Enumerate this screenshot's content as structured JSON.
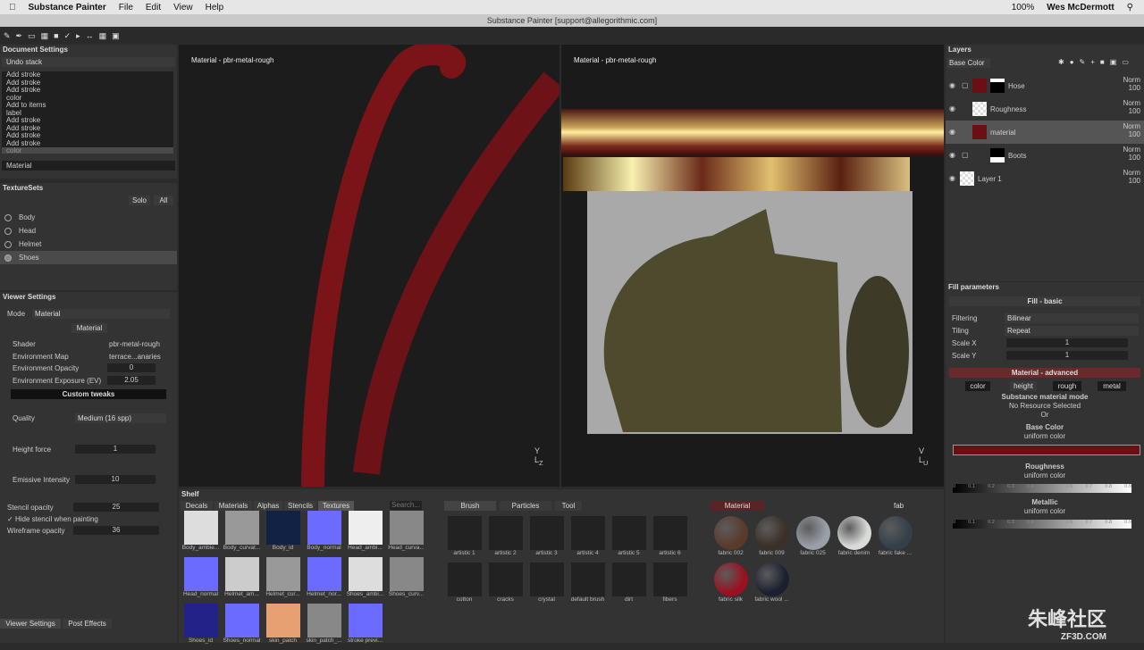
{
  "menubar": {
    "app": "Substance Painter",
    "items": [
      "File",
      "Edit",
      "View",
      "Help"
    ],
    "battery": "100%",
    "user": "Wes McDermott"
  },
  "window": {
    "title": "Substance Painter [support@allegorithmic.com]"
  },
  "doc": {
    "title": "Document Settings",
    "undo_header": "Undo stack",
    "undo": [
      "Add stroke",
      "Add stroke",
      "Add stroke",
      "color",
      "Add to items",
      "label",
      "Add stroke",
      "Add stroke",
      "Add stroke",
      "Add stroke",
      "color"
    ],
    "footer": "Material"
  },
  "texturesets": {
    "title": "TextureSets",
    "solo": "Solo",
    "all": "All",
    "items": [
      "Body",
      "Head",
      "Helmet",
      "Shoes"
    ]
  },
  "viewer": {
    "title": "Viewer Settings",
    "mode_label": "Mode",
    "mode": "Material",
    "tab": "Material",
    "shader_label": "Shader",
    "shader": "pbr-metal-rough",
    "envmap_label": "Environment Map",
    "envmap": "terrace...anaries",
    "envop_label": "Environment Opacity",
    "envop": "0",
    "envexp_label": "Environment Exposure (EV)",
    "envexp": "2.05",
    "custom": "Custom tweaks",
    "quality_label": "Quality",
    "quality": "Medium (16 spp)",
    "height_label": "Height force",
    "height": "1",
    "emissive_label": "Emissive Intensity",
    "emissive": "10",
    "stencil_label": "Stencil opacity",
    "stencil": "25",
    "hide_label": "Hide stencil when painting",
    "wire_label": "Wireframe opacity",
    "wire": "36",
    "tab1": "Viewer Settings",
    "tab2": "Post Effects"
  },
  "viewport": {
    "left_label": "Material - pbr-metal-rough",
    "right_label": "Material - pbr-metal-rough"
  },
  "layers": {
    "title": "Layers",
    "channel": "Base Color",
    "items": [
      {
        "name": "Hose",
        "blend": "Norm",
        "op": "100"
      },
      {
        "name": "Roughness",
        "blend": "Norm",
        "op": "100"
      },
      {
        "name": "material",
        "blend": "Norm",
        "op": "100"
      },
      {
        "name": "Boots",
        "blend": "Norm",
        "op": "100"
      },
      {
        "name": "Layer 1",
        "blend": "Norm",
        "op": "100"
      }
    ]
  },
  "fill": {
    "title": "Fill parameters",
    "basic": "Fill - basic",
    "filtering_label": "Filtering",
    "filtering": "Bilinear",
    "tiling_label": "Tiling",
    "tiling": "Repeat",
    "scalex_label": "Scale X",
    "scalex": "1",
    "scaley_label": "Scale Y",
    "scaley": "1",
    "advanced": "Material - advanced",
    "channels": [
      "color",
      "height",
      "rough",
      "metal"
    ],
    "mode": "Substance material mode",
    "noresource": "No Resource Selected",
    "or": "Or",
    "base": "Base Color",
    "uniform": "uniform color",
    "rough": "Roughness",
    "metallic": "Metallic",
    "ticks": [
      "0",
      "0.1",
      "0.2",
      "0.3",
      "0.4",
      "0.5",
      "0.6",
      "0.7",
      "0.8",
      "0.9"
    ],
    "base_color": "#6a0f14"
  },
  "shelf": {
    "title": "Shelf",
    "tabs": [
      "Decals",
      "Materials",
      "Alphas",
      "Stencils",
      "Textures"
    ],
    "search": "Search...",
    "textures": [
      "Body_ambie...",
      "Body_curvat...",
      "Body_id",
      "Body_normal",
      "Head_ambi...",
      "Head_curva...",
      "Head_normal",
      "Helmet_am...",
      "Helmet_cur...",
      "Helmet_nor...",
      "Shoes_ambi...",
      "Shoes_curv...",
      "Shoes_id",
      "Shoes_normal",
      "skin_patch",
      "skin_patch_...",
      "stroke previ..."
    ],
    "brush_tabs": [
      "Brush",
      "Particles",
      "Tool"
    ],
    "brushes": [
      "artistic 1",
      "artistic 2",
      "artistic 3",
      "artistic 4",
      "artistic 5",
      "artistic 6",
      "cotton",
      "cracks",
      "crystal",
      "default brush",
      "dirt",
      "fibers"
    ],
    "mat_tab": "Material",
    "mat_search": "fab",
    "materials": [
      "fabric 002",
      "fabric 009",
      "fabric 025",
      "fabric denim",
      "fabric fake ...",
      "fabric silk",
      "fabric wool ..."
    ]
  },
  "watermark": "朱峰社区",
  "watermark2": "ZF3D.COM"
}
